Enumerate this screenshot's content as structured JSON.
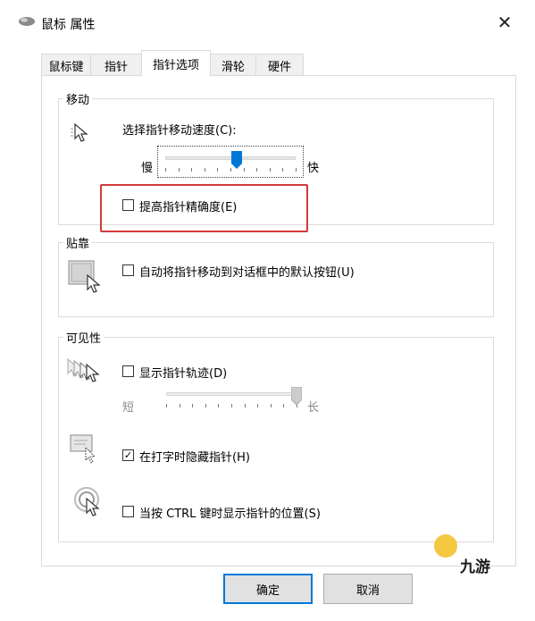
{
  "window": {
    "title": "鼠标 属性",
    "close_glyph": "✕",
    "icon": "mouse-icon"
  },
  "tabs": [
    {
      "label": "鼠标键",
      "active": false
    },
    {
      "label": "指针",
      "active": false
    },
    {
      "label": "指针选项",
      "active": true
    },
    {
      "label": "滑轮",
      "active": false
    },
    {
      "label": "硬件",
      "active": false
    }
  ],
  "motion": {
    "group_title": "移动",
    "speed_label": "选择指针移动速度(C):",
    "slow_label": "慢",
    "fast_label": "快",
    "speed_level": 0.55,
    "precision_label": "提高指针精确度(E)",
    "precision_checked": false
  },
  "snap": {
    "group_title": "贴靠",
    "snap_label": "自动将指针移动到对话框中的默认按钮(U)",
    "snap_checked": false
  },
  "visibility": {
    "group_title": "可见性",
    "trails_label": "显示指针轨迹(D)",
    "trails_checked": false,
    "short_label": "短",
    "long_label": "长",
    "trails_level": 1.0,
    "hide_label": "在打字时隐藏指针(H)",
    "hide_checked": true,
    "hide_check_glyph": "✓",
    "ctrl_label": "当按 CTRL 键时显示指针的位置(S)",
    "ctrl_checked": false
  },
  "buttons": {
    "ok": "确定",
    "cancel": "取消"
  },
  "watermark": {
    "text": "九游"
  },
  "colors": {
    "highlight": "#d23b3b",
    "accent": "#0078d7"
  }
}
